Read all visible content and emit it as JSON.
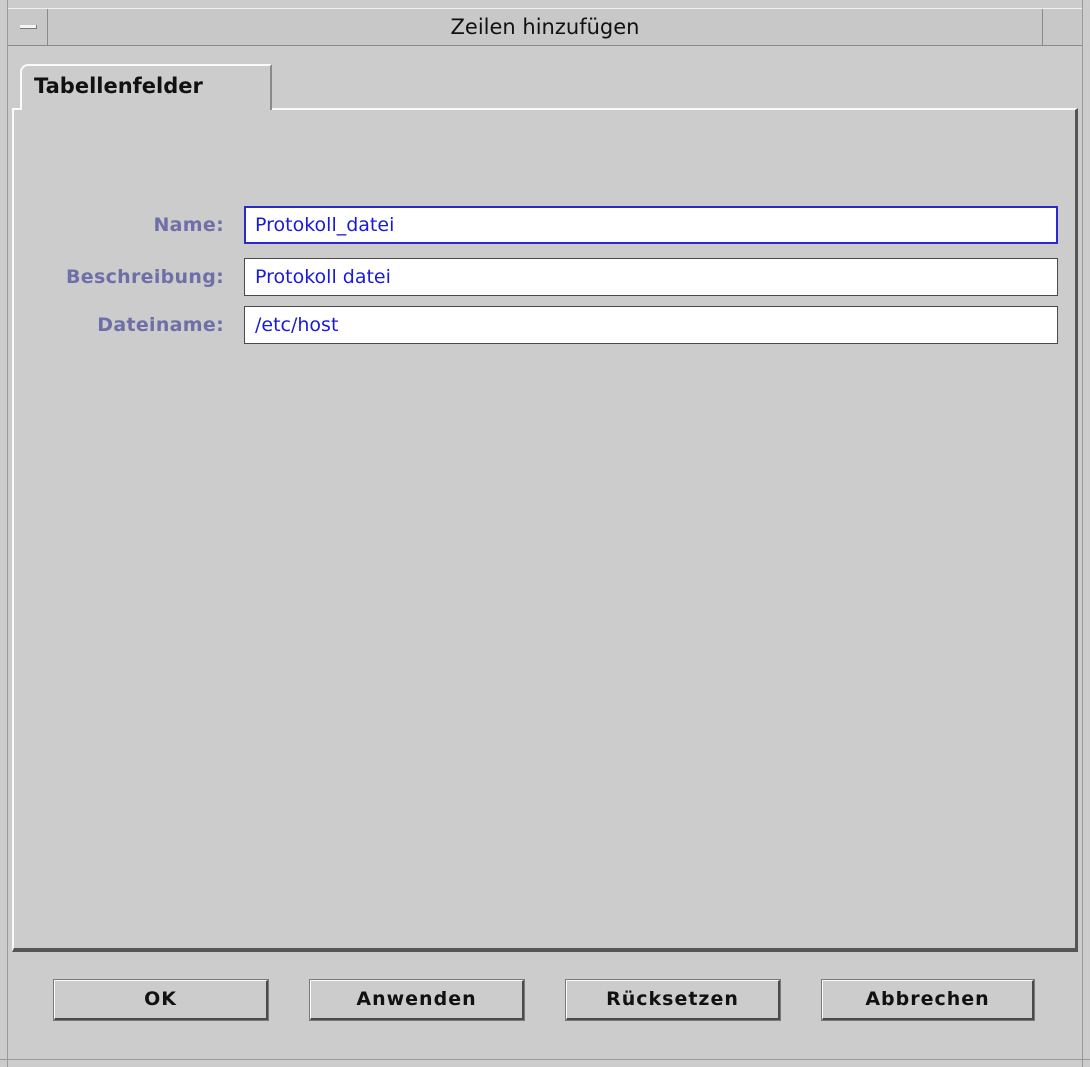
{
  "window": {
    "title": "Zeilen hinzufügen"
  },
  "tabs": [
    {
      "label": "Tabellenfelder",
      "active": true
    }
  ],
  "form": {
    "fields": [
      {
        "label": "Name:",
        "value": "Protokoll_datei",
        "focused": true
      },
      {
        "label": "Beschreibung:",
        "value": "Protokoll datei",
        "focused": false
      },
      {
        "label": "Dateiname:",
        "value": "/etc/host",
        "focused": false
      }
    ]
  },
  "buttons": {
    "ok": "OK",
    "apply": "Anwenden",
    "reset": "Rücksetzen",
    "cancel": "Abbrechen"
  },
  "colors": {
    "background": "#cccccc",
    "label_text": "#6f6fa8",
    "input_text": "#1a1ad8",
    "focus_border": "#2a2acc"
  },
  "icons": {
    "window_menu": "window-menu-icon"
  }
}
